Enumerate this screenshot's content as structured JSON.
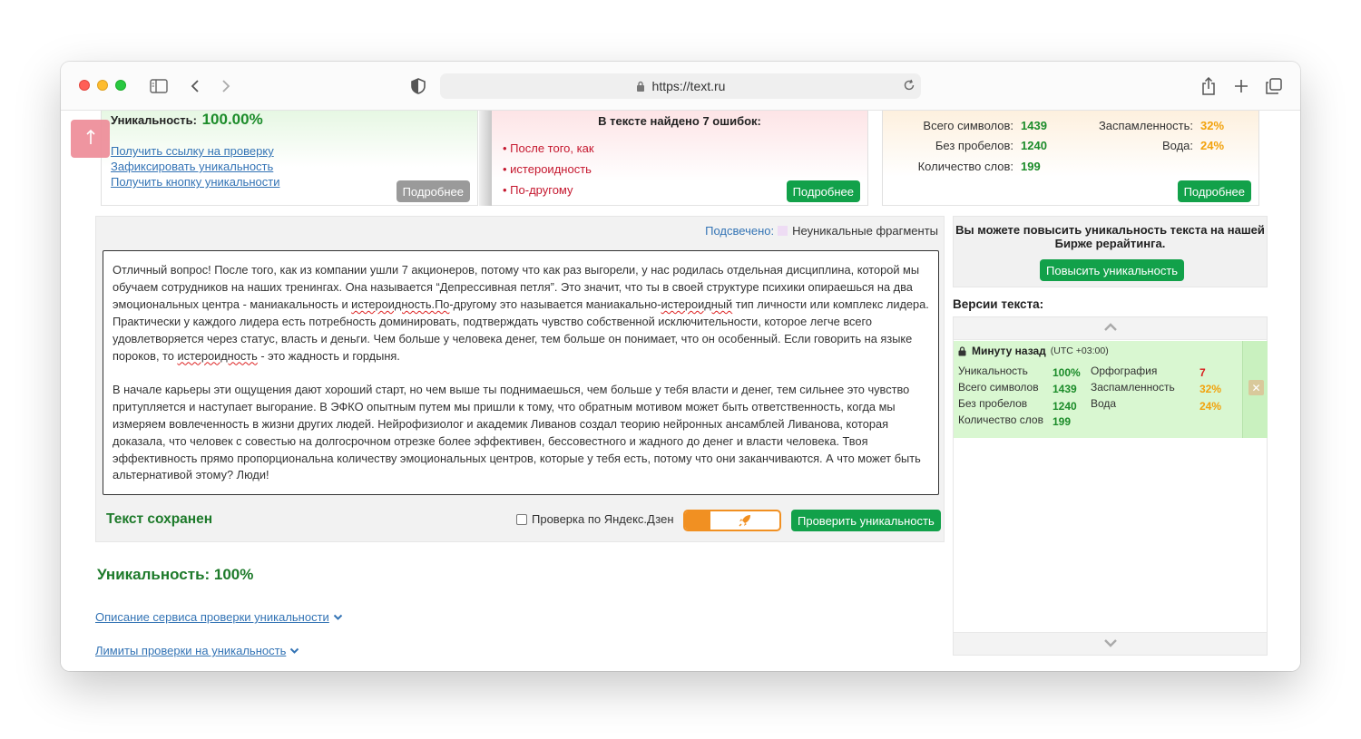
{
  "browser": {
    "url": "https://text.ru"
  },
  "top": {
    "uniqueness": {
      "label": "Уникальность:",
      "value": "100.00%",
      "links": [
        "Получить ссылку на проверку",
        "Зафиксировать уникальность",
        "Получить кнопку уникальности"
      ],
      "more_label": "Подробнее"
    },
    "errors": {
      "title": "В тексте найдено 7 ошибок:",
      "items": [
        "После того, как",
        "истероидность",
        "По-другому"
      ],
      "more_label": "Подробнее"
    },
    "stats": {
      "total_chars_label": "Всего символов:",
      "total_chars": "1439",
      "no_spaces_label": "Без пробелов:",
      "no_spaces": "1240",
      "words_label": "Количество слов:",
      "words": "199",
      "spam_label": "Заспамленность:",
      "spam": "32%",
      "water_label": "Вода:",
      "water": "24%",
      "more_label": "Подробнее"
    }
  },
  "scroll_top_icon": "arrow-up-icon",
  "editor": {
    "highlight_label": "Подсвечено:",
    "highlight_legend": "Неуникальные фрагменты",
    "p1_a": "Отличный вопрос! После того, как из компании ушли 7 акционеров, потому что как раз выгорели, у нас родилась отдельная дисциплина, которой мы обучаем сотрудников на наших тренингах. Она называется “Депрессивная петля”. Это значит, что ты в своей структуре психики опираешься на два эмоциональных центра - маниакальность и ",
    "p1_err1": "истероидность.По",
    "p1_b": "-другому это называется маниакально-",
    "p1_err2": "истероидный",
    "p1_c": " тип личности или комплекс лидера. Практически у каждого лидера есть потребность доминировать, подтверждать чувство собственной исключительности, которое легче всего удовлетворяется через статус, власть и деньги. Чем больше у человека денег, тем больше он понимает, что он особенный. Если говорить на языке пороков, то ",
    "p1_err3": "истероидность",
    "p1_d": " - это жадность и гордыня.",
    "p2": "В начале карьеры эти ощущения дают хороший старт, но чем выше ты поднимаешься, чем больше у тебя власти и денег, тем сильнее это чувство притупляется и наступает выгорание. В ЭФКО опытным путем мы пришли к тому, что обратным мотивом может быть ответственность, когда мы измеряем вовлеченность в жизни других людей. Нейрофизиолог и академик Ливанов создал теорию нейронных ансамблей Ливанова, которая доказала, что человек с совестью на долгосрочном отрезке более эффективен, бессовестного и жадного до денег и власти человека. Твоя эффективность прямо пропорциональна количеству эмоциональных центров, которые у тебя есть, потому что они заканчиваются. А что может быть альтернативой этому? Люди!",
    "saved_status": "Текст сохранен",
    "yandex_label": "Проверка по Яндекс.Дзен",
    "yandex_checked": false,
    "check_button": "Проверить уникальность"
  },
  "result": {
    "text": "Уникальность: 100%"
  },
  "links": {
    "description": "Описание сервиса проверки уникальности",
    "limits": "Лимиты проверки на уникальность"
  },
  "promo": {
    "text": "Вы можете повысить уникальность текста на нашей Бирже рерайтинга.",
    "button": "Повысить уникальность"
  },
  "versions": {
    "title": "Версии текста:",
    "item": {
      "time": "Минуту назад",
      "timezone": "(UTC +03:00)",
      "uniq_label": "Уникальность",
      "uniq": "100%",
      "spelling_label": "Орфография",
      "spelling": "7",
      "chars_label": "Всего символов",
      "chars": "1439",
      "spam_label": "Заспамленность",
      "spam": "32%",
      "nospace_label": "Без пробелов",
      "nospace": "1240",
      "water_label": "Вода",
      "water": "24%",
      "words_label": "Количество слов",
      "words": "199"
    }
  },
  "colors": {
    "accent_green": "#12a14a",
    "uniq_green": "#1c8c2a",
    "error_red": "#c5172e",
    "warn_orange": "#f2a20c",
    "link_blue": "#3474b5"
  }
}
